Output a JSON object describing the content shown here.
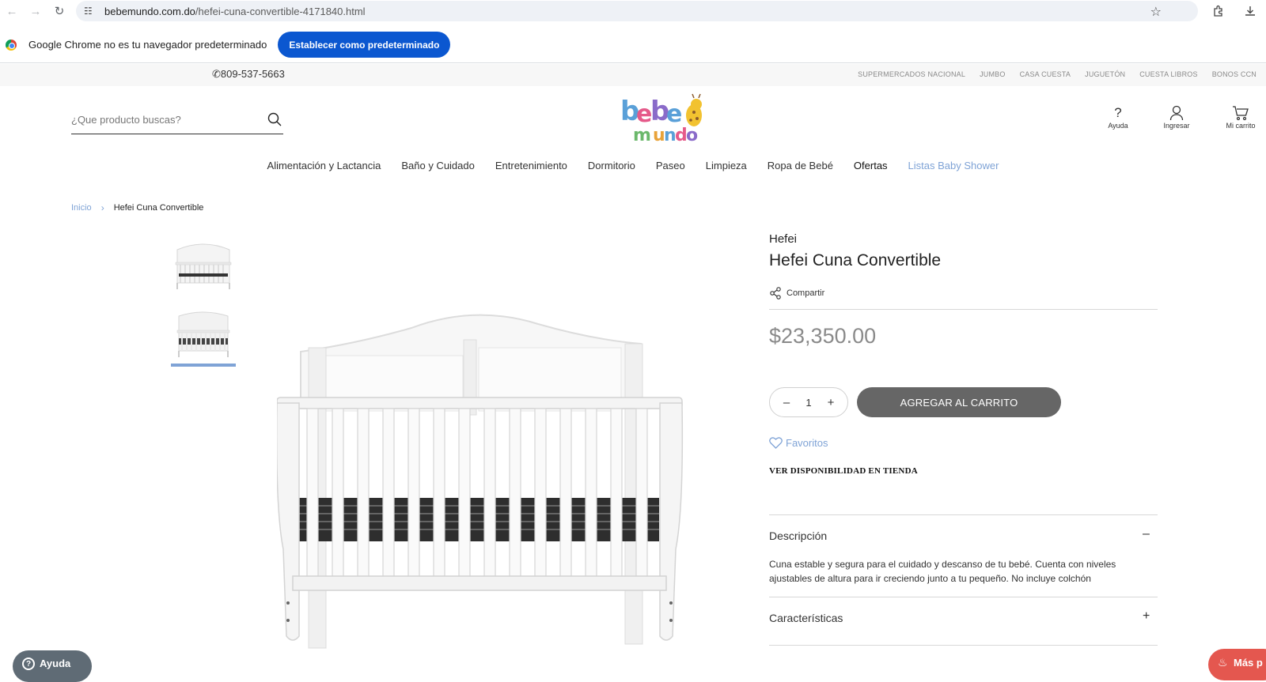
{
  "browser": {
    "url_host": "bebemundo.com.do",
    "url_path": "/hefei-cuna-convertible-4171840.html",
    "infobar_message": "Google Chrome no es tu navegador predeterminado",
    "infobar_button": "Establecer como predeterminado",
    "icons": [
      "back-icon",
      "forward-icon",
      "reload-icon",
      "site-settings-icon",
      "bookmark-star-icon",
      "extensions-icon",
      "download-icon"
    ]
  },
  "topbar": {
    "phone": "809-537-5663",
    "partners": [
      "SUPERMERCADOS NACIONAL",
      "JUMBO",
      "CASA CUESTA",
      "JUGUETÓN",
      "CUESTA LIBROS",
      "BONOS CCN"
    ]
  },
  "header": {
    "search_placeholder": "¿Que producto buscas?",
    "tools": [
      {
        "label": "Ayuda",
        "icon": "help-icon"
      },
      {
        "label": "Ingresar",
        "icon": "user-icon"
      },
      {
        "label": "Mi carrito",
        "icon": "cart-icon"
      }
    ]
  },
  "nav": {
    "items": [
      "Alimentación y Lactancia",
      "Baño y Cuidado",
      "Entretenimiento",
      "Dormitorio",
      "Paseo",
      "Limpieza",
      "Ropa de Bebé",
      "Ofertas",
      "Listas Baby Shower"
    ]
  },
  "breadcrumb": {
    "home": "Inicio",
    "current": "Hefei Cuna Convertible"
  },
  "product": {
    "brand": "Hefei",
    "title": "Hefei Cuna Convertible",
    "share_label": "Compartir",
    "price": "$23,350.00",
    "quantity": "1",
    "qty_minus": "–",
    "qty_plus": "+",
    "add_to_cart": "AGREGAR AL CARRITO",
    "favorites": "Favoritos",
    "availability": "VER DISPONIBILIDAD EN TIENDA",
    "description_title": "Descripción",
    "description_toggle": "–",
    "description_text": "Cuna estable y segura para el cuidado y descanso de tu bebé. Cuenta con niveles ajustables de altura para ir creciendo junto a tu pequeño. No incluye colchón",
    "features_title": "Características",
    "features_toggle": "+"
  },
  "widgets": {
    "help": "Ayuda",
    "more": "Más p"
  },
  "colors": {
    "accent_blue": "#7fa3d6",
    "chrome_blue": "#0b57d0",
    "cart_button": "#666666",
    "promo_red": "#e4574f"
  }
}
